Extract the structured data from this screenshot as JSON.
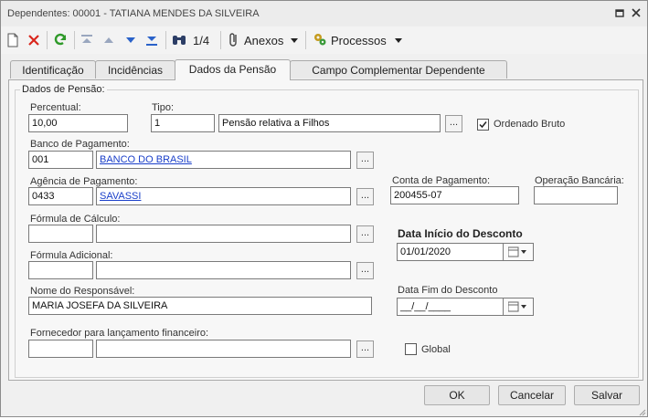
{
  "window": {
    "title": "Dependentes: 00001 - TATIANA MENDES DA SILVEIRA",
    "restore_icon": "restore-icon",
    "close_icon": "close-icon"
  },
  "toolbar": {
    "record_counter": "1/4",
    "anexos_label": "Anexos",
    "processos_label": "Processos"
  },
  "tabs": [
    {
      "label": "Identificação",
      "active": false
    },
    {
      "label": "Incidências",
      "active": false
    },
    {
      "label": "Dados da Pensão",
      "active": true
    },
    {
      "label": "Campo Complementar Dependente",
      "active": false
    }
  ],
  "form": {
    "group_title": "Dados de Pensão:",
    "percentual": {
      "label": "Percentual:",
      "value": "10,00"
    },
    "tipo": {
      "label": "Tipo:",
      "code": "1",
      "description": "Pensão relativa a Filhos"
    },
    "ordenado_bruto": {
      "label": "Ordenado Bruto",
      "checked": true
    },
    "banco": {
      "label": "Banco de  Pagamento:",
      "code": "001",
      "name": "BANCO DO BRASIL"
    },
    "agencia": {
      "label": "Agência de Pagamento:",
      "code": "0433",
      "name": "SAVASSI"
    },
    "conta": {
      "label": "Conta de Pagamento:",
      "value": "200455-07"
    },
    "operacao": {
      "label": "Operação Bancária:",
      "value": ""
    },
    "formula_calculo": {
      "label": "Fórmula de Cálculo:",
      "code": "",
      "name": ""
    },
    "formula_adicional": {
      "label": "Fórmula Adicional:",
      "code": "",
      "name": ""
    },
    "data_inicio": {
      "label": "Data Início do Desconto",
      "value": "01/01/2020"
    },
    "data_fim": {
      "label": "Data Fim do Desconto",
      "value": "__/__/____"
    },
    "responsavel": {
      "label": "Nome do Responsável:",
      "value": "MARIA JOSEFA DA SILVEIRA"
    },
    "fornecedor": {
      "label": "Fornecedor para lançamento financeiro:",
      "code": "",
      "name": ""
    },
    "global": {
      "label": "Global",
      "checked": false
    },
    "lookup_button_label": "..."
  },
  "footer": {
    "ok_label": "OK",
    "cancel_label": "Cancelar",
    "save_label": "Salvar"
  },
  "colors": {
    "link": "#1a3fc9",
    "delete_red": "#d9261c",
    "refresh_green": "#2f9a2a",
    "nav_blue": "#2a62c9"
  }
}
